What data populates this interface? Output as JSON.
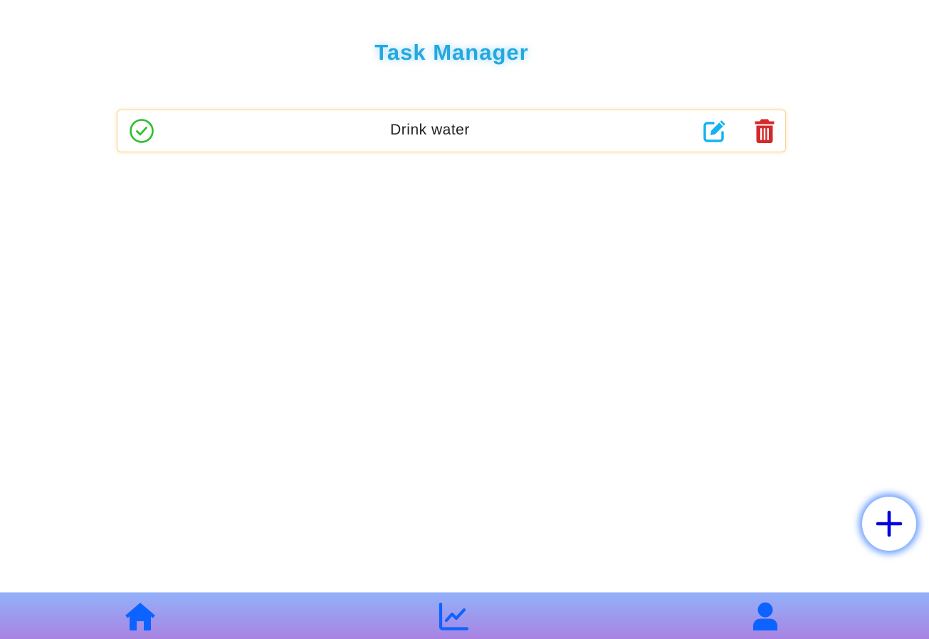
{
  "app": {
    "title": "Task Manager"
  },
  "tasks": [
    {
      "text": "Drink water",
      "status_icon": "check-circle-icon",
      "actions": [
        "edit-icon",
        "trash-icon"
      ]
    }
  ],
  "fab": {
    "icon": "plus-icon"
  },
  "bottom_nav": {
    "items": [
      {
        "icon": "home-icon"
      },
      {
        "icon": "chart-line-icon"
      },
      {
        "icon": "user-icon"
      }
    ]
  },
  "colors": {
    "title": "#24a8e0",
    "check": "#2cbf2c",
    "edit": "#12b3ee",
    "delete": "#d42a2a",
    "fab_plus": "#0000e0",
    "nav_icon": "#0d63ff",
    "nav_gradient_top": "#93b1fa",
    "nav_gradient_bottom": "#a883e2",
    "task_border": "#f6d79a"
  }
}
